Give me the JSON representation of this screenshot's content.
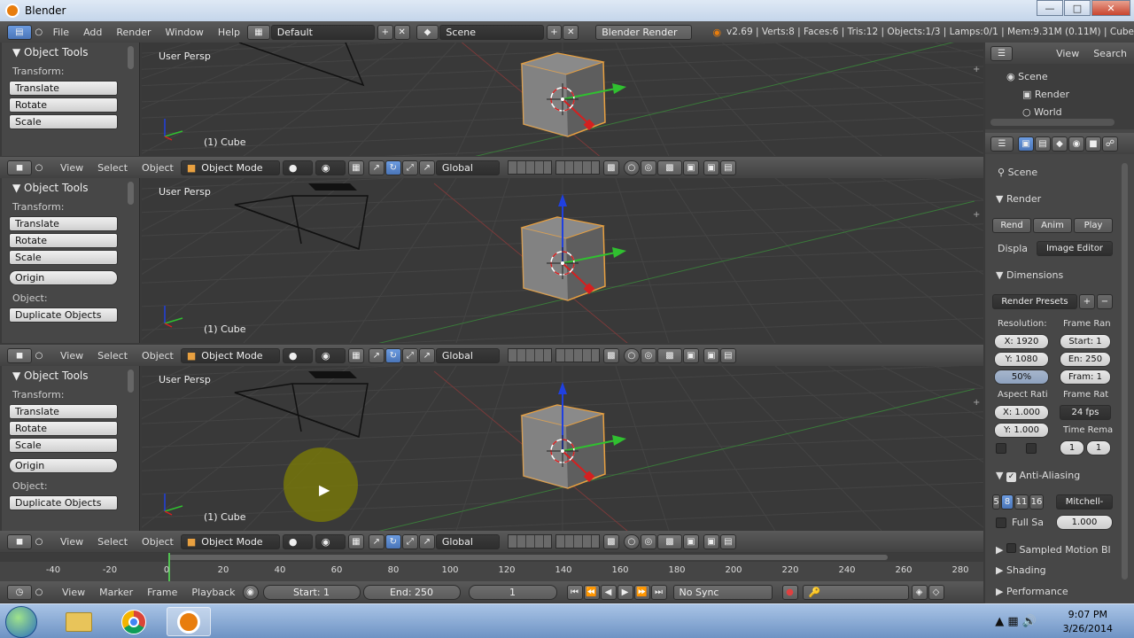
{
  "window": {
    "title": "Blender"
  },
  "info_header": {
    "menus": [
      "File",
      "Add",
      "Render",
      "Window",
      "Help"
    ],
    "layout": "Default",
    "scene": "Scene",
    "engine": "Blender Render",
    "stats": "v2.69 | Verts:8 | Faces:6 | Tris:12 | Objects:1/3 | Lamps:0/1 | Mem:9.31M (0.11M) | Cube"
  },
  "tool_panel": {
    "title": "Object Tools",
    "transform_label": "Transform:",
    "translate": "Translate",
    "rotate": "Rotate",
    "scale": "Scale",
    "origin": "Origin",
    "object_label": "Object:",
    "duplicate": "Duplicate Objects"
  },
  "viewport": {
    "label": "User Persp",
    "object": "(1) Cube"
  },
  "view3d_header": {
    "view": "View",
    "select": "Select",
    "object": "Object",
    "mode": "Object Mode",
    "orientation": "Global"
  },
  "outliner": {
    "view": "View",
    "search": "Search",
    "items": [
      "Scene",
      "Render",
      "World"
    ]
  },
  "properties": {
    "scene": "Scene",
    "render_section": "Render",
    "render_btn": "Rend",
    "anim_btn": "Anim",
    "play_btn": "Play",
    "display_label": "Displa",
    "display_value": "Image Editor",
    "dimensions_section": "Dimensions",
    "presets": "Render Presets",
    "resolution_label": "Resolution:",
    "frame_range_label": "Frame Ran",
    "res_x": "X: 1920",
    "res_y": "Y: 1080",
    "res_pct": "50%",
    "start": "Start: 1",
    "end": "En: 250",
    "frame_step": "Fram: 1",
    "aspect_label": "Aspect Rati",
    "frame_rate_label": "Frame Rat",
    "aspect_x": "X: 1.000",
    "aspect_y": "Y: 1.000",
    "fps": "24 fps",
    "time_remap_label": "Time Rema",
    "remap_old": "1",
    "remap_new": "1",
    "aa_section": "Anti-Aliasing",
    "aa_samples": [
      "5",
      "8",
      "11",
      "16"
    ],
    "aa_filter": "Mitchell-",
    "full_sample": "Full Sa",
    "filter_size": "1.000",
    "motion_blur": "Sampled Motion Bl",
    "shading": "Shading",
    "performance": "Performance"
  },
  "timeline": {
    "ticks": [
      "-40",
      "-20",
      "0",
      "20",
      "40",
      "60",
      "80",
      "100",
      "120",
      "140",
      "160",
      "180",
      "200",
      "220",
      "240",
      "260",
      "280"
    ],
    "view": "View",
    "marker": "Marker",
    "frame": "Frame",
    "playback": "Playback",
    "start": "Start: 1",
    "end": "End: 250",
    "current": "1",
    "sync": "No Sync"
  },
  "taskbar": {
    "time": "9:07 PM",
    "date": "3/26/2014"
  },
  "colors": {
    "selection": "#e8a040",
    "x_axis": "#d42020",
    "y_axis": "#30c030",
    "z_axis": "#2040e0",
    "highlight": "#6b9be0"
  }
}
